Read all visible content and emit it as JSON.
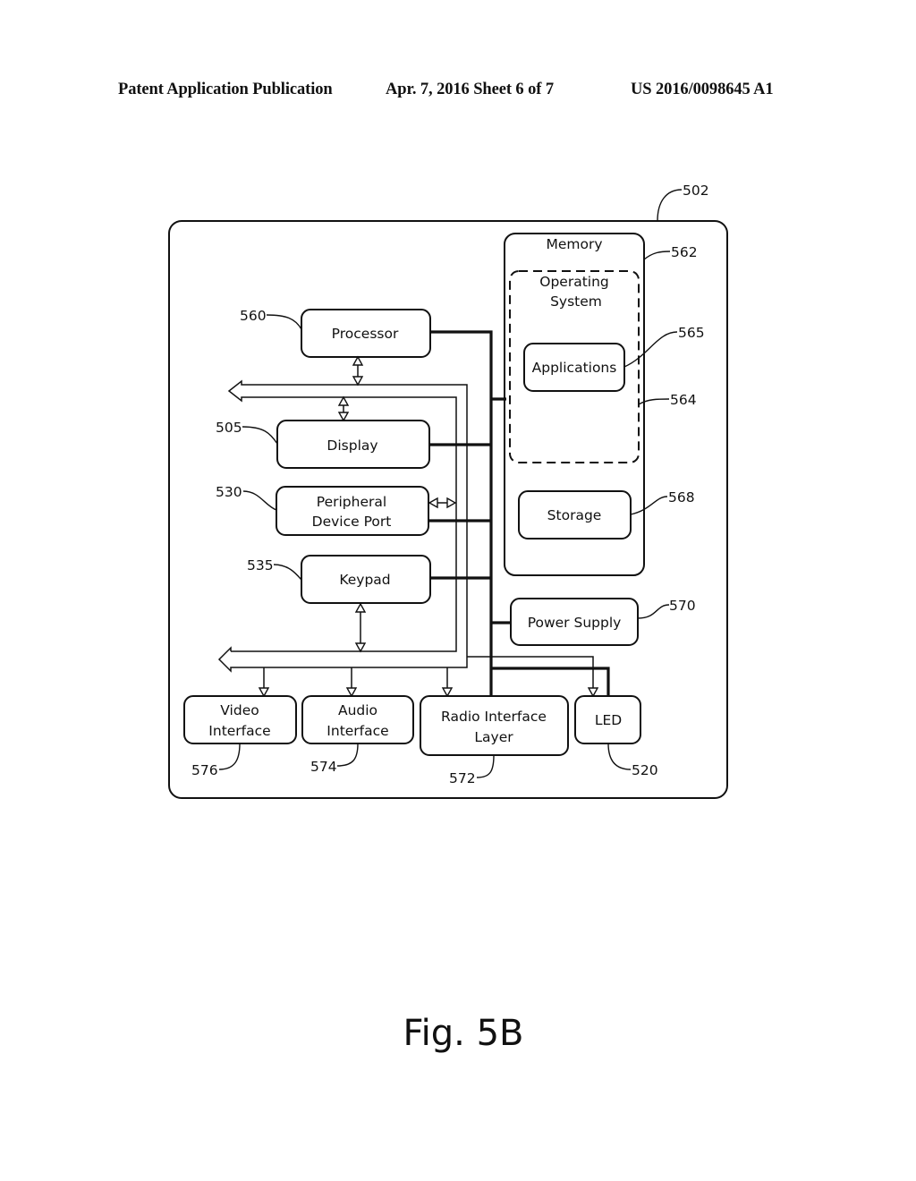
{
  "header": {
    "publication": "Patent Application Publication",
    "date_sheet": "Apr. 7, 2016   Sheet 6 of 7",
    "number": "US 2016/0098645 A1"
  },
  "diagram": {
    "device": {
      "ref": "502"
    },
    "memory": {
      "label": "Memory",
      "ref": "562"
    },
    "operating_system": {
      "label_line1": "Operating",
      "label_line2": "System",
      "ref": "564"
    },
    "applications": {
      "label": "Applications",
      "ref": "565"
    },
    "storage": {
      "label": "Storage",
      "ref": "568"
    },
    "processor": {
      "label": "Processor",
      "ref": "560"
    },
    "display": {
      "label": "Display",
      "ref": "505"
    },
    "peripheral_port": {
      "label_line1": "Peripheral",
      "label_line2": "Device Port",
      "ref": "530"
    },
    "keypad": {
      "label": "Keypad",
      "ref": "535"
    },
    "power_supply": {
      "label": "Power Supply",
      "ref": "570"
    },
    "video_interface": {
      "label_line1": "Video",
      "label_line2": "Interface",
      "ref": "576"
    },
    "audio_interface": {
      "label_line1": "Audio",
      "label_line2": "Interface",
      "ref": "574"
    },
    "radio_interface": {
      "label_line1": "Radio Interface",
      "label_line2": "Layer",
      "ref": "572"
    },
    "led": {
      "label": "LED",
      "ref": "520"
    }
  },
  "caption": "Fig. 5B"
}
